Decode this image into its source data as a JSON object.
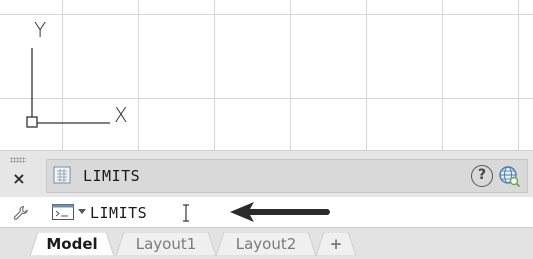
{
  "canvas": {
    "axis_y_label": "Y",
    "axis_x_label": "X",
    "grid_color": "#d6d6d6",
    "axis_color": "#333333"
  },
  "command_history": {
    "close_symbol": "×",
    "last_command": "LIMITS",
    "help_symbol": "?"
  },
  "command_line": {
    "value": "LIMITS",
    "annotation_arrow_color": "#2b2b2b"
  },
  "tabs": [
    {
      "label": "Model",
      "active": true
    },
    {
      "label": "Layout1",
      "active": false
    },
    {
      "label": "Layout2",
      "active": false
    },
    {
      "label": "+",
      "active": false
    }
  ]
}
